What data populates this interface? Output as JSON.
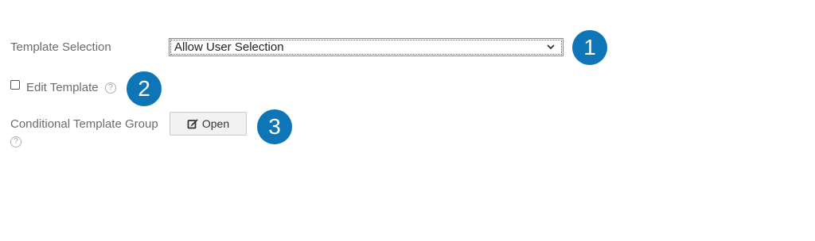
{
  "template_selection": {
    "label": "Template Selection",
    "value": "Allow User Selection"
  },
  "edit_template": {
    "label": "Edit Template",
    "checked": false,
    "help_glyph": "?"
  },
  "conditional_group": {
    "label": "Conditional Template Group",
    "help_glyph": "?",
    "open_button": {
      "label": "Open",
      "icon": "edit-icon"
    }
  },
  "callouts": [
    "1",
    "2",
    "3"
  ],
  "colors": {
    "callout_bg": "#0e76b6",
    "label_text": "#6b6b6b",
    "button_bg": "#f2f2f2"
  }
}
